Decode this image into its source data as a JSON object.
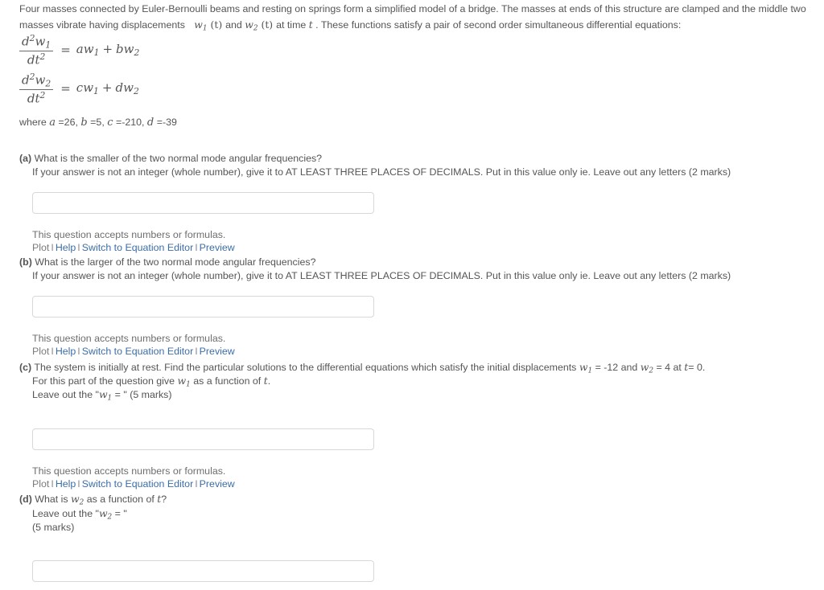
{
  "intro": {
    "text_part1": "Four masses connected by Euler-Bernoulli beams and resting on springs form a simplified model of a bridge. The masses at ends of this structure are clamped and the middle two masses vibrate having displacements",
    "disp1": "w",
    "disp1_sub": "1",
    "disp1_arg": "(t)",
    "and": "and",
    "disp2": "w",
    "disp2_sub": "2",
    "disp2_arg": "(t)",
    "text_part2": "at time",
    "time_var": "t",
    "text_part3": ". These functions satisfy a pair of second order simultaneous differential equations:"
  },
  "equations": [
    {
      "num_d": "d",
      "num_sup": "2",
      "num_w": "w",
      "num_sub": "1",
      "den_dt": "dt",
      "den_sup": "2",
      "rel": "=",
      "coef1": "a",
      "var1": "w",
      "var1_sub": "1",
      "op": "+",
      "coef2": "b",
      "var2": "w",
      "var2_sub": "2"
    },
    {
      "num_d": "d",
      "num_sup": "2",
      "num_w": "w",
      "num_sub": "2",
      "den_dt": "dt",
      "den_sup": "2",
      "rel": "=",
      "coef1": "c",
      "var1": "w",
      "var1_sub": "1",
      "op": "+",
      "coef2": "d",
      "var2": "w",
      "var2_sub": "2"
    }
  ],
  "where": {
    "label": "where",
    "params": [
      {
        "name": "a",
        "eq": "=",
        "value": "26",
        "trail": ","
      },
      {
        "name": "b",
        "eq": "=",
        "value": "5",
        "trail": ","
      },
      {
        "name": "c",
        "eq": "=",
        "value": "-210",
        "trail": ","
      },
      {
        "name": "d",
        "eq": "=",
        "value": "-39",
        "trail": ""
      }
    ]
  },
  "questions": {
    "a": {
      "label": "(a)",
      "prompt": "What is the smaller of the two normal mode angular frequencies?",
      "instruction": "If your answer is not an integer (whole number), give it to AT LEAST THREE PLACES OF DECIMALS. Put in this value only ie. Leave out any letters (2 marks)",
      "input_value": "",
      "input_placeholder": ""
    },
    "b": {
      "label": "(b)",
      "prompt": "What is the larger of the two normal mode angular frequencies?",
      "instruction": "If your answer is not an integer (whole number), give it to AT LEAST THREE PLACES OF DECIMALS. Put in this value only ie. Leave out any letters (2 marks)",
      "input_value": "",
      "input_placeholder": ""
    },
    "c": {
      "label": "(c)",
      "prompt_p1": "The system is initially at rest. Find the particular solutions to the differential equations which satisfy the initial displacements",
      "w1": "w",
      "w1_sub": "1",
      "w1_eq": "= -12 and",
      "w2": "w",
      "w2_sub": "2",
      "w2_eq": "= 4 at",
      "t_var": "t",
      "t_eq": "= 0.",
      "line2_p1": "For this part of the question give",
      "line2_w": "w",
      "line2_w_sub": "1",
      "line2_p2": "as a function of",
      "line2_t": "t",
      "line2_p3": ".",
      "line3_p1": "Leave out the \"",
      "line3_w": "w",
      "line3_w_sub": "1",
      "line3_p2": "= \" (5 marks)",
      "input_value": "",
      "input_placeholder": ""
    },
    "d": {
      "label": "(d)",
      "prompt_p1": "What is",
      "w": "w",
      "w_sub": "2",
      "prompt_p2": "as a function of",
      "t_var": "t",
      "prompt_p3": "?",
      "line2_p1": "Leave out the \"",
      "line2_w": "w",
      "line2_w_sub": "2",
      "line2_p2": "= \"",
      "line3": "(5 marks)",
      "input_value": "",
      "input_placeholder": ""
    }
  },
  "tools": {
    "accepts_note": "This question accepts numbers or formulas.",
    "plot": "Plot",
    "help": "Help",
    "switch_editor": "Switch to Equation Editor",
    "preview": "Preview",
    "separator": "I",
    "link_color": "#3c6ea8",
    "text_color": "#555555"
  }
}
